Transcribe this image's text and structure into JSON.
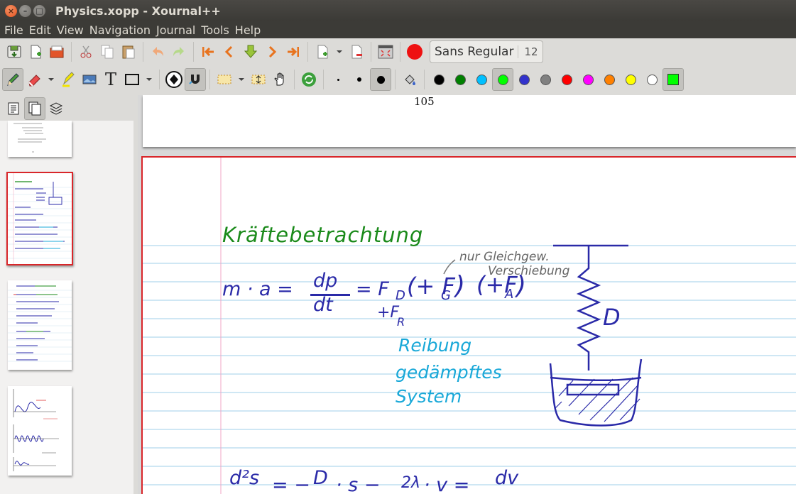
{
  "window": {
    "title": "Physics.xopp - Xournal++"
  },
  "menu": [
    "File",
    "Edit",
    "View",
    "Navigation",
    "Journal",
    "Tools",
    "Help"
  ],
  "toolbar": {
    "font_name": "Sans Regular",
    "font_size": "12",
    "colors": [
      "#000000",
      "#008000",
      "#00c0ff",
      "#00ff00",
      "#3333cc",
      "#808080",
      "#ff0000",
      "#ff00ff",
      "#ff8000",
      "#ffff00",
      "#ffffff"
    ],
    "active_color": "#00ff00"
  },
  "page": {
    "number_above": "105",
    "notes": {
      "heading": "Kräftebetrachtung",
      "annotation_line1": "nur Gleichgew.",
      "annotation_line2": "Verschiebung",
      "equation_lhs": "m · a =",
      "frac_num": "dp",
      "frac_den": "dt",
      "equation_rhs": "= F",
      "sub_d": "D",
      "paren_open": "(+ F",
      "sub_g": "G",
      "paren_close": ")",
      "plus_fa": "(+F",
      "sub_a": "A",
      "plus_fr": "+F",
      "sub_r": "R",
      "reibung": "Reibung",
      "gedaempftes": "gedämpftes",
      "system": "System",
      "spring_label": "D",
      "eq2_num": "d²s",
      "eq2_rest": "= −",
      "eq2_d": "D",
      "eq2_s": "· s  −",
      "eq2_lambda": "2λ",
      "eq2_v": "· v  =",
      "eq2_dv": "dv"
    }
  }
}
